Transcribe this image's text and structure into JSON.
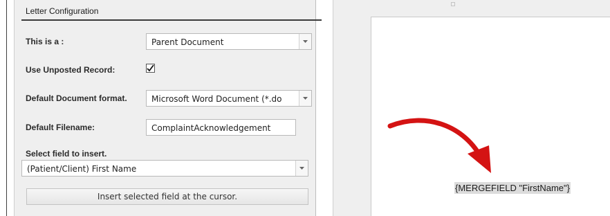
{
  "panel": {
    "title": "Letter Configuration"
  },
  "form": {
    "doc_type": {
      "label": "This is a :",
      "value": "Parent Document"
    },
    "unposted": {
      "label": "Use Unposted Record:",
      "checked": true
    },
    "format": {
      "label": "Default Document format.",
      "value": "Microsoft Word Document (*.do"
    },
    "filename": {
      "label": "Default Filename:",
      "value": "ComplaintAcknowledgement"
    },
    "insert_field": {
      "label": "Select field to insert.",
      "value": "(Patient/Client) First Name"
    },
    "insert_button": "Insert selected field at the cursor."
  },
  "document": {
    "merge_field": "{MERGEFIELD \"FirstName\"}"
  },
  "icons": {
    "dropdown": "chevron-down-icon",
    "check": "checkmark-icon",
    "annotation": "red-arrow-icon"
  },
  "colors": {
    "arrow": "#d41313",
    "panel_bg": "#efefef",
    "highlight": "#dcdcdc"
  }
}
